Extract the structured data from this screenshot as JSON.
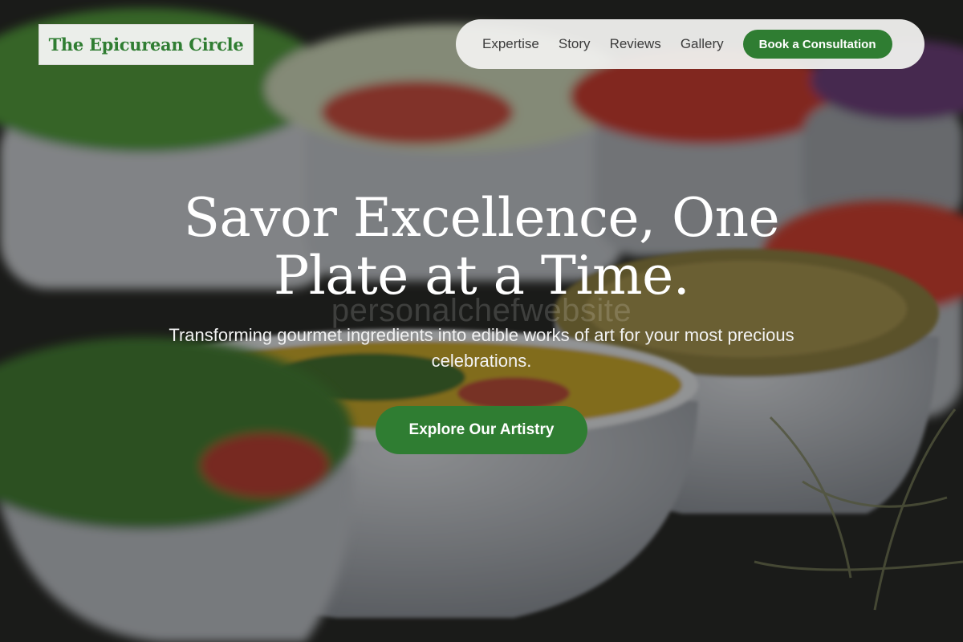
{
  "brand": {
    "name": "The Epicurean Circle"
  },
  "nav": {
    "links": [
      "Expertise",
      "Story",
      "Reviews",
      "Gallery"
    ],
    "cta_label": "Book a Consultation"
  },
  "hero": {
    "headline_line1": "Savor Excellence, One",
    "headline_line2": "Plate at a Time.",
    "watermark": "personalchefwebsite",
    "subtitle": "Transforming gourmet ingredients into edible works of art for your most precious celebrations.",
    "cta_label": "Explore Our Artistry",
    "background_image": "salad-bowls-buffet-photo"
  },
  "colors": {
    "brand_green": "#2f7d32",
    "nav_background": "#f0f0ee",
    "headline_text": "#ffffff"
  }
}
